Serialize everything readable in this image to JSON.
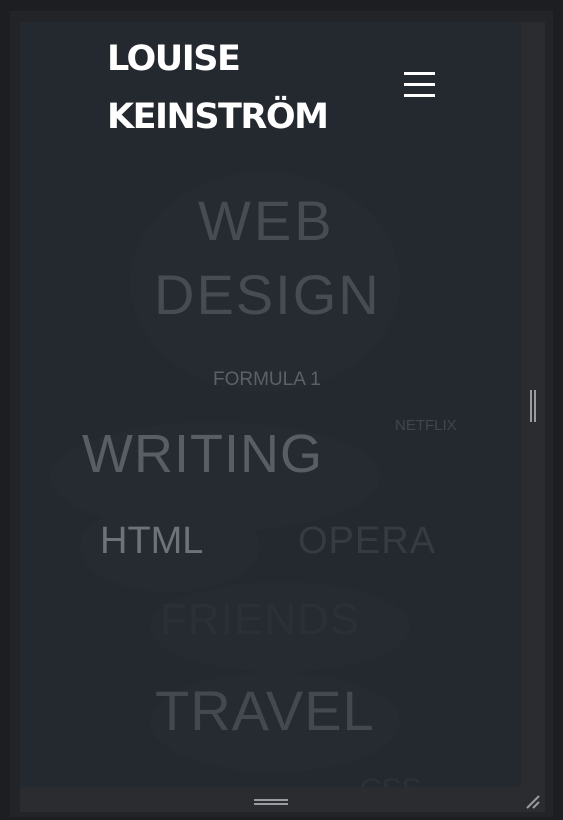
{
  "header": {
    "title_line1": "LOUISE",
    "title_line2": "KEINSTRÖM",
    "menu_icon": "hamburger-menu-icon"
  },
  "tags": {
    "web": "WEB",
    "design": "DESIGN",
    "formula1": "FORMULA 1",
    "netflix": "NETFLIX",
    "writing": "WRITING",
    "html": "HTML",
    "opera": "OPERA",
    "friends": "FRIENDS",
    "travel": "TRAVEL",
    "partial": "CSS"
  },
  "resize_handles": {
    "vertical": "vertical-resize-grip-icon",
    "horizontal": "horizontal-resize-grip-icon",
    "corner": "corner-resize-grip-icon"
  },
  "colors": {
    "page_background": "#24292f",
    "frame": "#1d1e21",
    "title": "#ffffff"
  }
}
